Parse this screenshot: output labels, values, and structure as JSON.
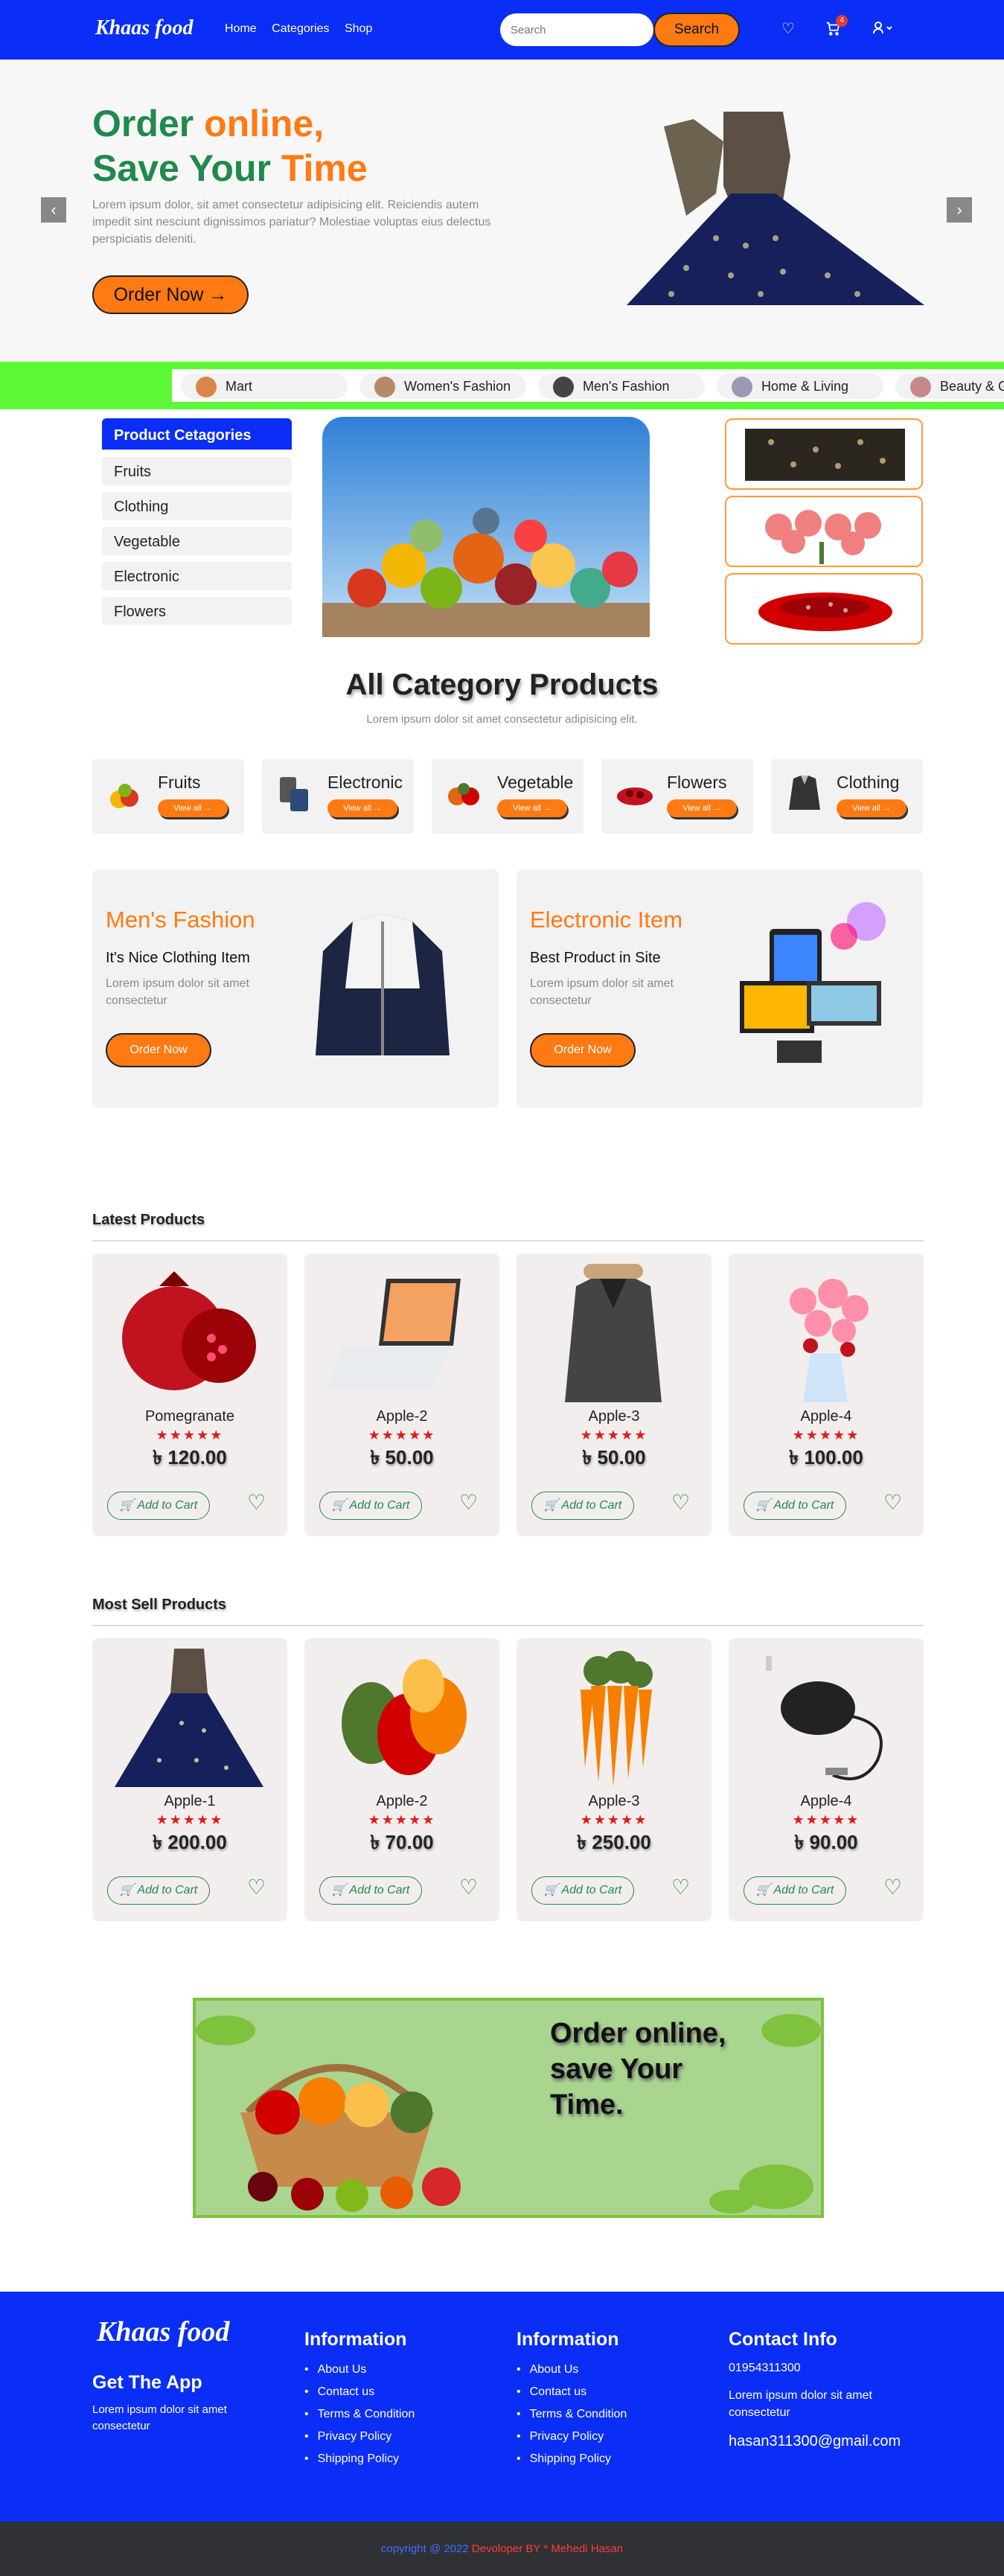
{
  "header": {
    "logo": "Khaas food",
    "nav": [
      "Home",
      "Categories",
      "Shop"
    ],
    "search_placeholder": "Search",
    "search_button": "Search",
    "cart_count": "4"
  },
  "hero": {
    "line1_a": "Order ",
    "line1_b": "online,",
    "line2_a": "Save Your ",
    "line2_b": "Time",
    "text": "Lorem ipsum dolor, sit amet consectetur adipisicing elit. Reiciendis autem impedit sint nesciunt dignissimos pariatur? Molestiae voluptas eius delectus perspiciatis deleniti.",
    "button": "Order Now"
  },
  "strip": [
    "Mart",
    "Women's Fashion",
    "Men's Fashion",
    "Home & Living",
    "Beauty & Grooming"
  ],
  "sidebar": {
    "title": "Product Cetagories",
    "items": [
      "Fruits",
      "Clothing",
      "Vegetable",
      "Electronic",
      "Flowers"
    ]
  },
  "all_category": {
    "title": "All Category Products",
    "subtitle": "Lorem ipsum dolor sit amet consectetur adipisicing elit.",
    "items": [
      "Fruits",
      "Electronic",
      "Vegetable",
      "Flowers",
      "Clothing"
    ],
    "view_all": "View all"
  },
  "promos": [
    {
      "title": "Men's Fashion",
      "subtitle": "It's Nice Clothing Item",
      "text": "Lorem ipsum dolor sit amet consectetur",
      "button": "Order Now"
    },
    {
      "title": "Electronic Item",
      "subtitle": "Best Product in Site",
      "text": "Lorem ipsum dolor sit amet consectetur",
      "button": "Order Now"
    }
  ],
  "latest": {
    "title": "Latest Products",
    "items": [
      {
        "name": "Pomegranate",
        "price": "৳ 120.00"
      },
      {
        "name": "Apple-2",
        "price": "৳ 50.00"
      },
      {
        "name": "Apple-3",
        "price": "৳ 50.00"
      },
      {
        "name": "Apple-4",
        "price": "৳ 100.00"
      }
    ]
  },
  "most_sell": {
    "title": "Most Sell Products",
    "items": [
      {
        "name": "Apple-1",
        "price": "৳ 200.00"
      },
      {
        "name": "Apple-2",
        "price": "৳ 70.00"
      },
      {
        "name": "Apple-3",
        "price": "৳ 250.00"
      },
      {
        "name": "Apple-4",
        "price": "৳ 90.00"
      }
    ]
  },
  "add_to_cart": "Add to Cart",
  "rating_stars": "★★★★★",
  "banner": {
    "line1": "Order online,",
    "line2": "save Your",
    "line3": "Time."
  },
  "footer": {
    "logo": "Khaas food",
    "app_title": "Get The App",
    "app_text": "Lorem ipsum dolor sit amet consectetur",
    "info_title": "Information",
    "links": [
      "About Us",
      "Contact us",
      "Terms & Condition",
      "Privacy Policy",
      "Shipping Policy"
    ],
    "contact_title": "Contact Info",
    "phone": "01954311300",
    "contact_text": "Lorem ipsum dolor sit amet consectetur",
    "email": "hasan311300@gmail.com",
    "copyright": "copyright @ 2022",
    "developer": "Devoloper BY * Mehedi Hasan"
  },
  "colors": {
    "brand_blue": "#0a2ef5",
    "accent_orange": "#ff7a13",
    "green": "#1f8a4c",
    "strip_green": "#5cf835"
  }
}
